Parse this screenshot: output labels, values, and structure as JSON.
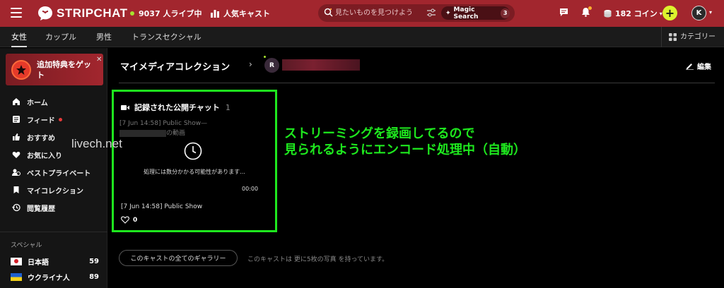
{
  "header": {
    "logo_text": "STRIPCHAT",
    "live_label": "9037 人ライブ中",
    "popular_label": "人気キャスト",
    "search_placeholder": "見たいものを見つけよう",
    "magic_search_label": "Magic Search",
    "magic_search_count": "3",
    "coins_label": "182 コイン",
    "avatar_initial": "K"
  },
  "categories": {
    "tabs": [
      "女性",
      "カップル",
      "男性",
      "トランスセクシャル"
    ],
    "active_index": 0,
    "category_button": "カテゴリー"
  },
  "sidebar": {
    "promo_text": "追加特典をゲット",
    "nav": [
      {
        "label": "ホーム",
        "icon": "home-icon"
      },
      {
        "label": "フィード",
        "icon": "feed-icon",
        "dot": true
      },
      {
        "label": "おすすめ",
        "icon": "thumbs-up-icon"
      },
      {
        "label": "お気に入り",
        "icon": "heart-icon"
      },
      {
        "label": "ベストプライベート",
        "icon": "private-icon"
      },
      {
        "label": "マイコレクション",
        "icon": "bookmark-icon"
      },
      {
        "label": "閲覧履歴",
        "icon": "history-icon"
      }
    ],
    "special_heading": "スペシャル",
    "countries": [
      {
        "label": "日本語",
        "count": "59",
        "flag": "japan-flag"
      },
      {
        "label": "ウクライナ人",
        "count": "89",
        "flag": "ukraine-flag"
      }
    ]
  },
  "main": {
    "title": "マイメディアコレクション",
    "user_initial": "R",
    "edit_label": "編集",
    "card": {
      "heading": "記録された公開チャット",
      "heading_count": "1",
      "alt_line1": "[7 Jun 14:58] Public Show—",
      "alt_line2": "の動画",
      "processing_text": "処理には数分かかる可能性があります...",
      "duration": "00:00",
      "title": "[7 Jun 14:58] Public Show",
      "likes": "0"
    },
    "gallery_button": "このキャストの全てのギャラリー",
    "gallery_note": "このキャストは 更に5枚の写真 を持っています。"
  },
  "annotation": {
    "line1": "ストリーミングを録画してるので",
    "line2": "見られるようにエンコード処理中（自動）",
    "watermark": "livech.net"
  },
  "colors": {
    "brand_red": "#a2262e",
    "highlight_green": "#1ee81e",
    "plus_yellow": "#dcf22e"
  }
}
